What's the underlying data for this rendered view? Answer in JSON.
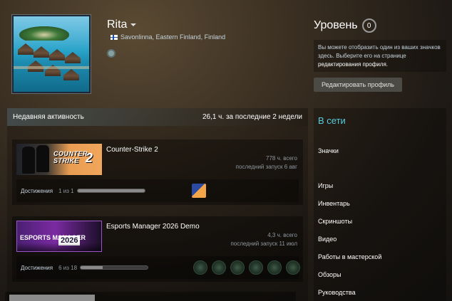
{
  "profile": {
    "persona_name": "Rita",
    "location": "Savonlinna, Eastern Finland, Finland"
  },
  "level": {
    "label": "Уровень",
    "value": "0",
    "badge_hint": "Вы можете отобразить один из ваших значков здесь. Выберите его на странице",
    "badge_hint_link": "редактирования профиля.",
    "edit_button": "Редактировать профиль"
  },
  "activity": {
    "title": "Недавняя активность",
    "hours_summary": "26,1 ч. за последние 2 недели",
    "achievements_label": "Достижения",
    "games": [
      {
        "name": "Counter-Strike 2",
        "hours": "778 ч. всего",
        "last_played": "последний запуск 6 авг",
        "achievements": "1 из 1",
        "progress": 1.0,
        "cap_logo": "COUNTER STRIKE",
        "cap_number": "2"
      },
      {
        "name": "Esports Manager 2026 Demo",
        "hours": "4,3 ч. всего",
        "last_played": "последний запуск 11 июл",
        "achievements": "6 из 18",
        "progress": 0.333,
        "cap_logo": "ESPORTS MANAGER",
        "cap_number": "2026"
      }
    ]
  },
  "sidebar": {
    "title": "В сети",
    "links": [
      "Значки",
      "Игры",
      "Инвентарь",
      "Скриншоты",
      "Видео",
      "Работы в мастерской",
      "Обзоры",
      "Руководства"
    ]
  },
  "colors": {
    "online_title": "#57cbde",
    "cs_cap": "#f0a65b",
    "em_cap": "#7b2aa2"
  },
  "icons": {
    "profile_menu": "caret-down-icon",
    "location_flag": "finland-flag-icon",
    "steam_status": "steam-globe-icon"
  }
}
